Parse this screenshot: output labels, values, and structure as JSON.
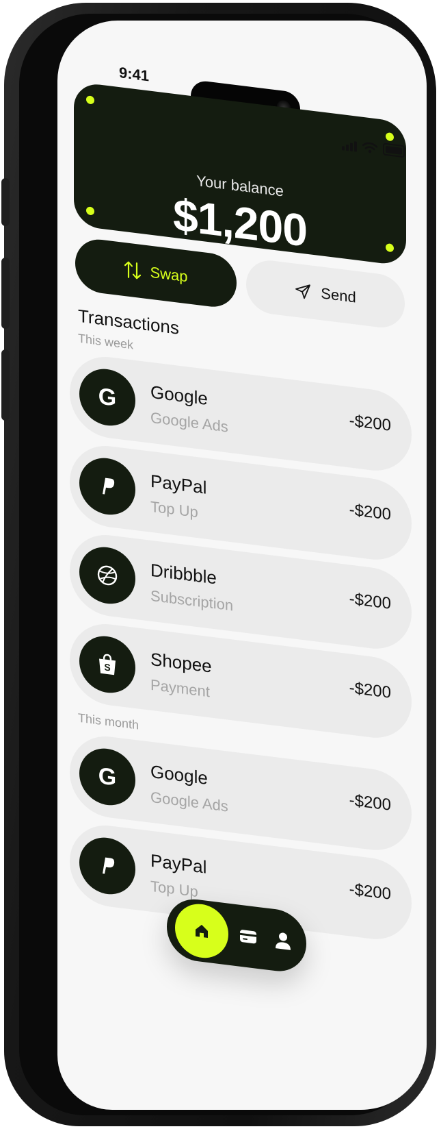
{
  "status": {
    "time": "9:41"
  },
  "balance": {
    "label": "Your balance",
    "value": "$1,200"
  },
  "actions": {
    "swap_label": "Swap",
    "send_label": "Send"
  },
  "transactions": {
    "title": "Transactions",
    "sections": [
      {
        "label": "This week",
        "items": [
          {
            "name": "Google",
            "subtitle": "Google Ads",
            "amount": "-$200",
            "icon": "google-icon"
          },
          {
            "name": "PayPal",
            "subtitle": "Top Up",
            "amount": "-$200",
            "icon": "paypal-icon"
          },
          {
            "name": "Dribbble",
            "subtitle": "Subscription",
            "amount": "-$200",
            "icon": "dribbble-icon"
          },
          {
            "name": "Shopee",
            "subtitle": "Payment",
            "amount": "-$200",
            "icon": "shopee-icon"
          }
        ]
      },
      {
        "label": "This month",
        "items": [
          {
            "name": "Google",
            "subtitle": "Google Ads",
            "amount": "-$200",
            "icon": "google-icon"
          },
          {
            "name": "PayPal",
            "subtitle": "Top Up",
            "amount": "-$200",
            "icon": "paypal-icon"
          }
        ]
      }
    ]
  },
  "nav": {
    "items": [
      "home-icon",
      "card-icon",
      "profile-icon"
    ],
    "active": "home-icon"
  },
  "colors": {
    "accent": "#d7ff1b",
    "dark": "#141c10",
    "card_bg": "#ebebeb",
    "muted_text": "#a5a5a5"
  }
}
